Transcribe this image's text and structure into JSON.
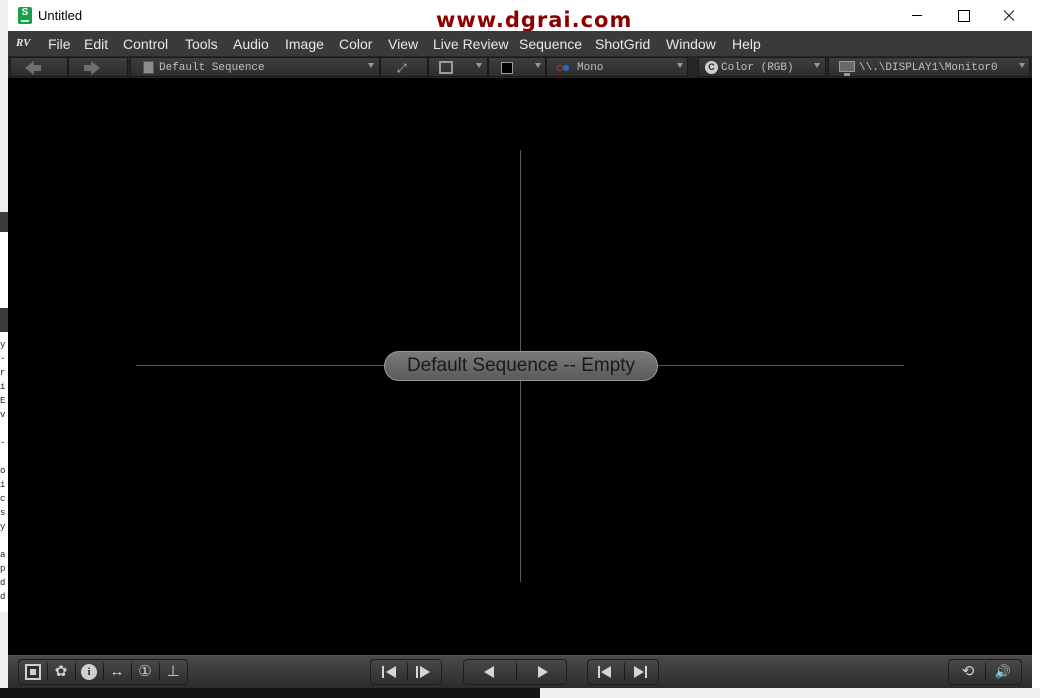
{
  "window": {
    "title": "Untitled",
    "app_icon_letter": "S",
    "watermark": "www.dgrai.com"
  },
  "menubar": {
    "logo": "RV",
    "items": [
      {
        "label": "File"
      },
      {
        "label": "Edit"
      },
      {
        "label": "Control"
      },
      {
        "label": "Tools"
      },
      {
        "label": "Audio"
      },
      {
        "label": "Image"
      },
      {
        "label": "Color"
      },
      {
        "label": "View"
      },
      {
        "label": "Live Review"
      },
      {
        "label": "Sequence"
      },
      {
        "label": "ShotGrid"
      },
      {
        "label": "Window"
      },
      {
        "label": "Help"
      }
    ]
  },
  "toolbar": {
    "sequence_select": "Default Sequence",
    "channel_select": "Mono",
    "color_select": "Color (RGB)",
    "color_icon_letter": "C",
    "display_select": "\\\\.\\DISPLAY1\\Monitor0",
    "mono_dot_colors": [
      "#c02a2a",
      "#2a6ad0"
    ]
  },
  "viewport": {
    "status": "Default Sequence -- Empty",
    "expand_glyph": "⤢"
  },
  "bottombar": {
    "left_buttons": [
      {
        "name": "session-manager-icon",
        "glyph": "⊡"
      },
      {
        "name": "color-wheel-icon",
        "glyph": "✿"
      },
      {
        "name": "info-icon",
        "glyph": "i"
      },
      {
        "name": "wipe-icon",
        "glyph": "↔"
      },
      {
        "name": "timer-icon",
        "glyph": "①"
      },
      {
        "name": "timeline-icon",
        "glyph": "⊥"
      }
    ],
    "volume_glyph": "🔊",
    "loop_glyph": "⟲"
  },
  "left_strip": {
    "chars": [
      "y",
      "-",
      "r",
      "i",
      "E",
      "v",
      "",
      "-",
      "",
      "o",
      "i",
      "c",
      "s",
      "y",
      "",
      "a",
      "p",
      "d",
      "d"
    ]
  }
}
